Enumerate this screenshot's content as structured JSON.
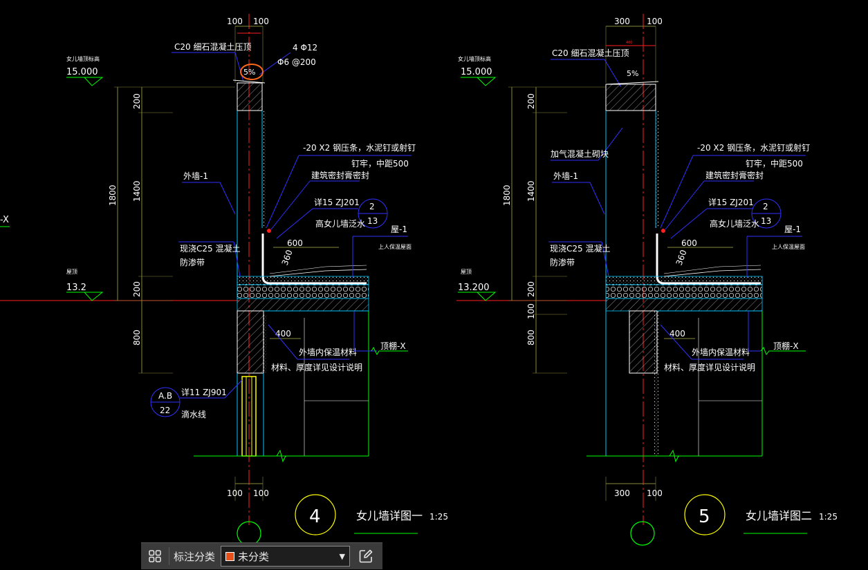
{
  "colors": {
    "background": "#000000",
    "red": "#ff2020",
    "cyan": "#00c8ff",
    "white": "#ffffff",
    "green": "#00ff00",
    "yellow": "#ffff00",
    "blue": "#3030ff",
    "orange": "#ff6a1a",
    "dim": "#8a8a3a",
    "swatch": "#e8501a"
  },
  "detail4": {
    "dim_top_a": "100",
    "dim_top_b": "100",
    "coping_label": "C20 细石混凝土压顶",
    "rebar_main": "4 Φ12",
    "rebar_stirrup": "Φ6 @200",
    "slope": "5%",
    "parapet_top_label": "女儿墙顶标高",
    "parapet_top_elev": "15.000",
    "dim_200a": "200",
    "dim_1400": "1400",
    "dim_1800": "1800",
    "dim_200b": "200",
    "dim_800": "800",
    "steel_strip_line1": "-20 X2 钢压条，水泥钉或射钉",
    "steel_strip_line2": "钉牢，中距500",
    "sealant": "建筑密封膏密封",
    "wall_label": "外墙-1",
    "ref_line": "详15 ZJ201",
    "callout_top": "2",
    "callout_bottom": "13",
    "flashing": "高女儿墙泛水",
    "floor_label": "屋-1",
    "roof_type": "上人保温屋面",
    "dim_600": "600",
    "dim_360": "360",
    "cast_label_1": "现浇C25 混凝土",
    "cast_label_2": "防渗带",
    "roof_level_label": "屋顶",
    "roof_level": "13.2",
    "dim_400": "400",
    "insul_1": "外墙内保温材料",
    "insul_2": "材料、厚度详见设计说明",
    "ceiling": "顶棚-X",
    "drip_ref": "详11 ZJ901",
    "drip_callout_top": "A.B",
    "drip_callout_bottom": "22",
    "drip_label": "滴水线",
    "dim_bot_a": "100",
    "dim_bot_b": "100",
    "number": "4",
    "title": "女儿墙详图一",
    "scale": "1:25"
  },
  "detail5": {
    "dim_top_a": "300",
    "dim_top_b": "100",
    "dim_tiny": "400",
    "coping_label": "C20 细石混凝土压顶",
    "slope": "5%",
    "parapet_top_label": "女儿墙顶标高",
    "parapet_top_elev": "15.000",
    "dim_200a": "200",
    "dim_1400": "1400",
    "dim_1800": "1800",
    "dim_200b": "200",
    "dim_100": "100",
    "dim_800": "800",
    "block_label": "加气混凝土砌块",
    "steel_strip_line1": "-20 X2 钢压条，水泥钉或射钉",
    "steel_strip_line2": "钉牢，中距500",
    "sealant": "建筑密封膏密封",
    "wall_label": "外墙-1",
    "ref_line": "详15 ZJ201",
    "callout_top": "2",
    "callout_bottom": "13",
    "flashing": "高女儿墙泛水",
    "floor_label": "屋-1",
    "roof_type": "上人保温屋面",
    "dim_600": "600",
    "dim_360": "360",
    "cast_label_1": "现浇C25 混凝土",
    "cast_label_2": "防渗带",
    "roof_level_label": "屋顶",
    "roof_level": "13.200",
    "dim_400": "400",
    "insul_1": "外墙内保温材料",
    "insul_2": "材料、厚度详见设计说明",
    "ceiling": "顶棚-X",
    "dim_bot_a": "300",
    "dim_bot_b": "100",
    "number": "5",
    "title": "女儿墙详图二",
    "scale": "1:25"
  },
  "edge_label": "-X",
  "toolbar": {
    "grid_icon": "grid-icon",
    "label": "标注分类",
    "selected": "未分类",
    "edit_icon": "edit-icon"
  }
}
